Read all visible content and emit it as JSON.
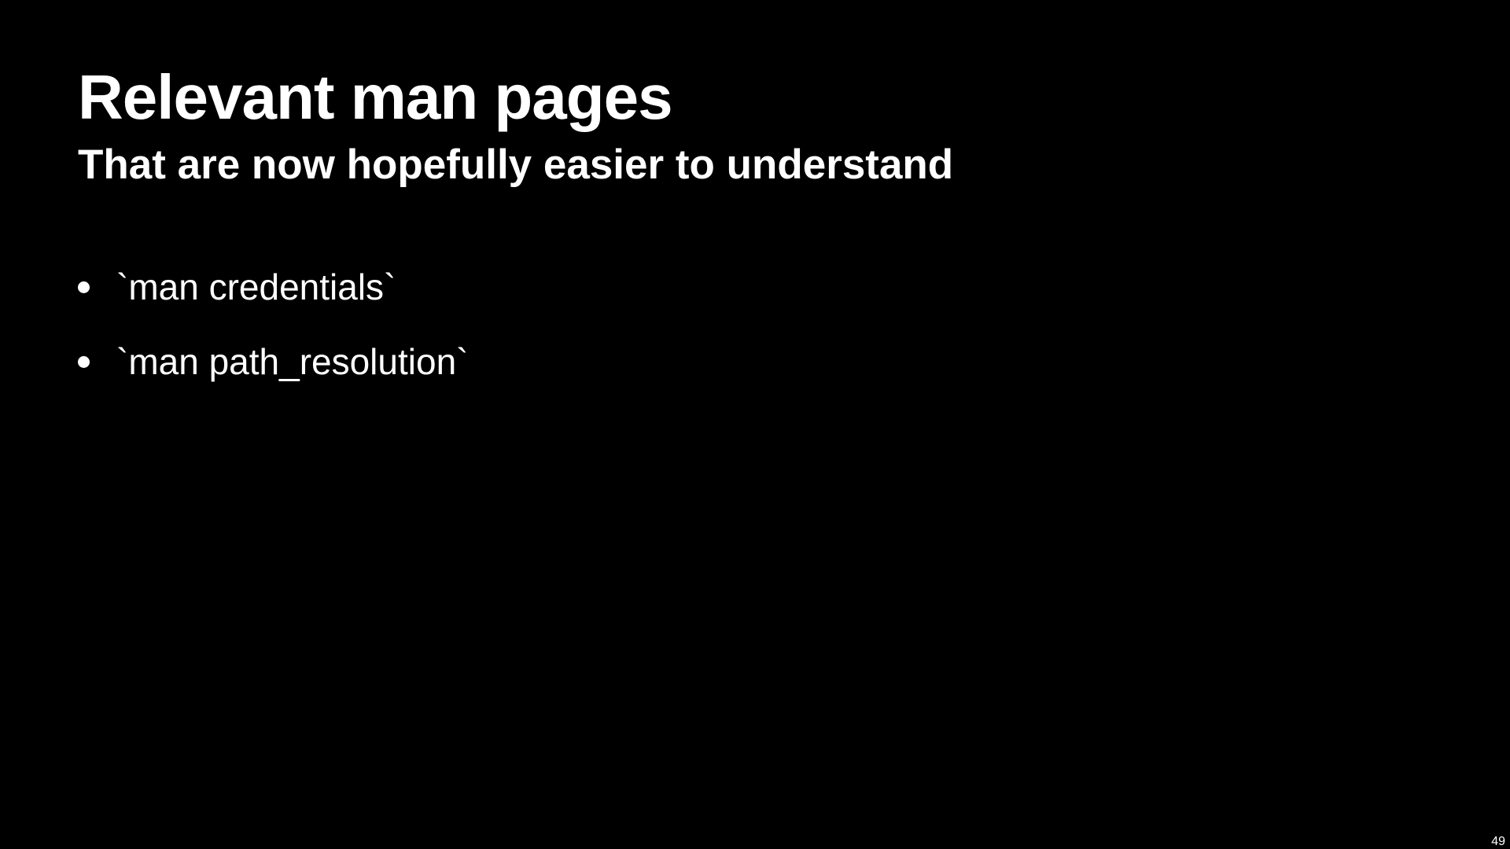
{
  "slide": {
    "title": "Relevant man pages",
    "subtitle": "That are now hopefully easier to understand",
    "bullets": [
      "`man credentials`",
      "`man path_resolution`"
    ],
    "page_number": "49"
  },
  "colors": {
    "background": "#000000",
    "text": "#ffffff"
  }
}
